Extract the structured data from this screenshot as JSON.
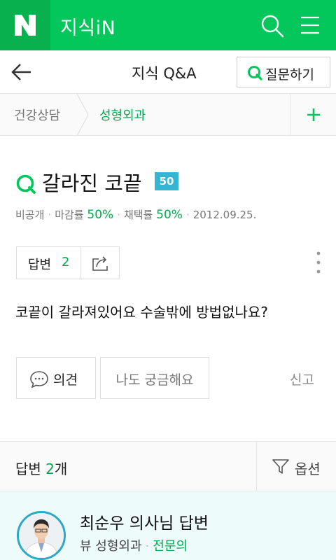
{
  "app": {
    "logo_letter": "N",
    "title": "지식iN"
  },
  "subheader": {
    "title": "지식 Q&A",
    "ask_button": "질문하기"
  },
  "breadcrumb": {
    "category": "건강상담",
    "subcategory": "성형외과"
  },
  "question": {
    "title": "갈라진 코끝",
    "level_badge": "50",
    "meta": {
      "visibility": "비공개",
      "deadline_label": "마감률",
      "deadline_value": "50%",
      "adoption_label": "채택률",
      "adoption_value": "50%",
      "date": "2012.09.25."
    },
    "answers_label": "답변",
    "answers_count": "2",
    "body": "코끝이 갈라져있어요 수술밖에 방법없나요?",
    "opinion_button": "의견",
    "curious_button": "나도 궁금해요",
    "report_link": "신고"
  },
  "answers_header": {
    "label": "답변",
    "count": "2",
    "suffix": "개",
    "options_button": "옵션"
  },
  "answer": {
    "author": "최순우 의사님 답변",
    "clinic": "뷰 성형외과",
    "role": "전문의"
  },
  "colors": {
    "brand_green": "#03c75a",
    "accent_green": "#03a94d",
    "badge_blue": "#35b5d0"
  }
}
